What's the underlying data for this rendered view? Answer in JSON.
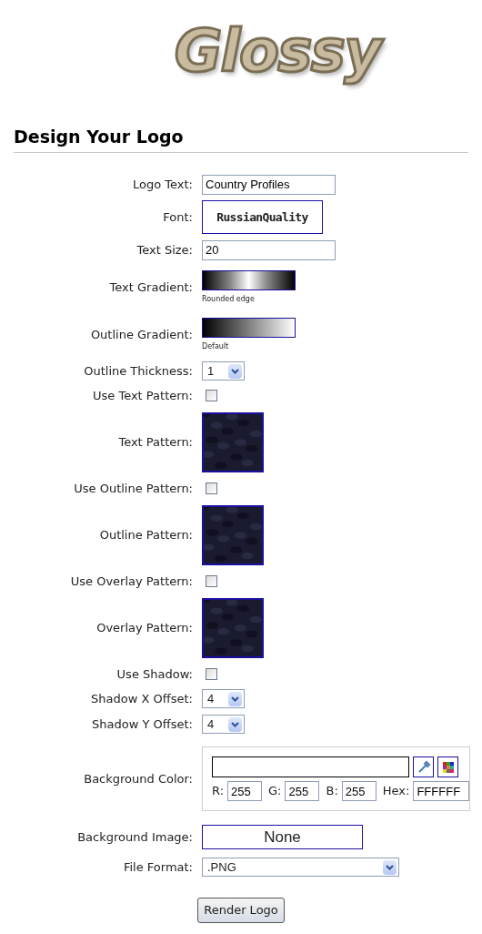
{
  "logo": "Glossy",
  "heading": "Design Your Logo",
  "rows": [
    {
      "kind": "text",
      "label": "Logo Text:",
      "value": "Country Profiles"
    },
    {
      "kind": "font",
      "label": "Font:",
      "value": "RussianQuality"
    },
    {
      "kind": "text",
      "label": "Text Size:",
      "value": "20"
    },
    {
      "kind": "bandgradient",
      "label": "Text Gradient:",
      "caption": "Rounded edge"
    },
    {
      "kind": "gradient",
      "label": "Outline Gradient:",
      "caption": "Default"
    },
    {
      "kind": "select",
      "label": "Outline Thickness:",
      "value": "1"
    },
    {
      "kind": "checkbox",
      "label": "Use Text Pattern:",
      "checked": false
    },
    {
      "kind": "pattern",
      "label": "Text Pattern:"
    },
    {
      "kind": "checkbox",
      "label": "Use Outline Pattern:",
      "checked": false
    },
    {
      "kind": "pattern",
      "label": "Outline Pattern:"
    },
    {
      "kind": "checkbox",
      "label": "Use Overlay Pattern:",
      "checked": false
    },
    {
      "kind": "pattern",
      "label": "Overlay Pattern:"
    },
    {
      "kind": "checkbox",
      "label": "Use Shadow:",
      "checked": false
    },
    {
      "kind": "select",
      "label": "Shadow X Offset:",
      "value": "4"
    },
    {
      "kind": "select",
      "label": "Shadow Y Offset:",
      "value": "4"
    },
    {
      "kind": "color",
      "label": "Background Color:",
      "r_label": "R:",
      "r": "255",
      "g_label": "G:",
      "g": "255",
      "b_label": "B:",
      "b": "255",
      "hex_label": "Hex:",
      "hex": "FFFFFF"
    },
    {
      "label": "Background Image:",
      "value": "None"
    },
    {
      "kind": "wideselect",
      "label": "File Format:",
      "value": ".PNG"
    }
  ],
  "button": "Render Logo"
}
